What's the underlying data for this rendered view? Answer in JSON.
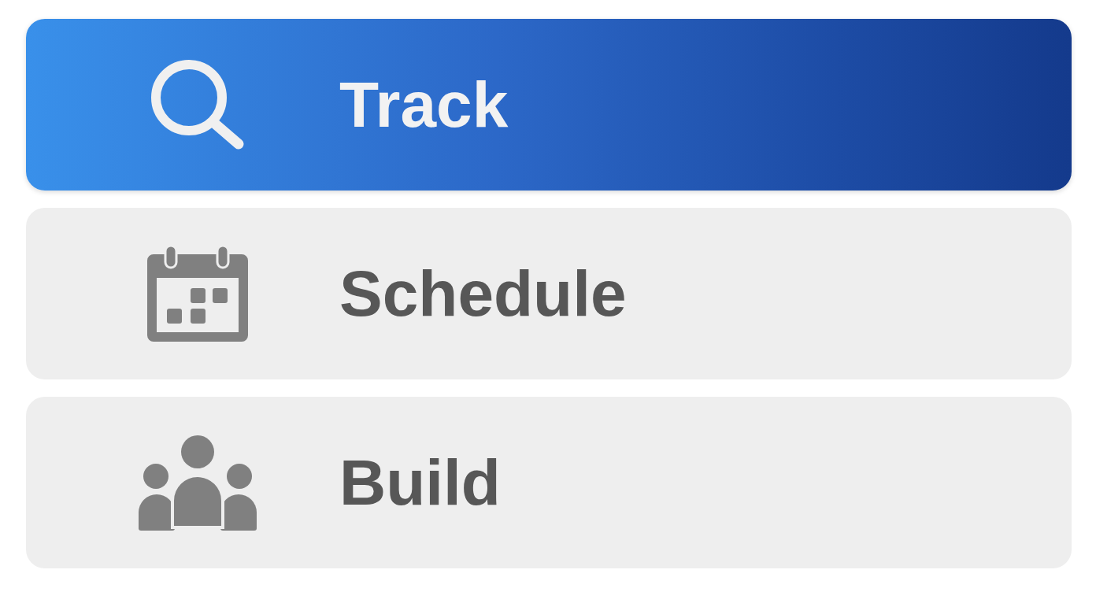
{
  "menu": {
    "items": [
      {
        "label": "Track",
        "kind": "search",
        "selected": true
      },
      {
        "label": "Schedule",
        "kind": "calendar",
        "selected": false
      },
      {
        "label": "Build",
        "kind": "people",
        "selected": false
      }
    ]
  }
}
